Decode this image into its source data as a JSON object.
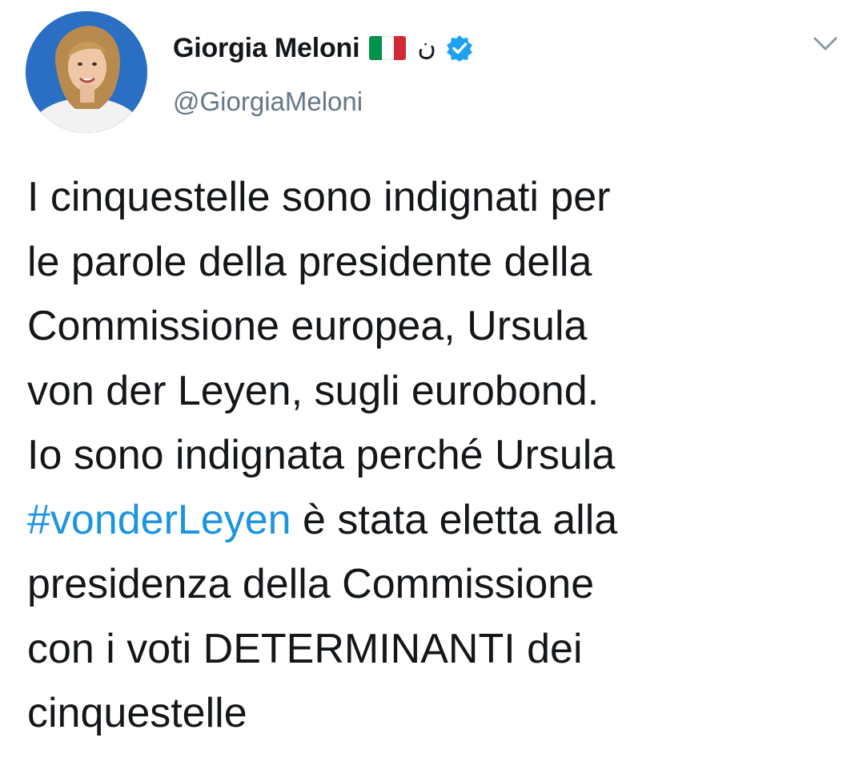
{
  "author": {
    "display_name": "Giorgia Meloni",
    "emoji_flag": "italian-flag",
    "arabic_glyph": "ن",
    "verified": true,
    "handle": "@GiorgiaMeloni"
  },
  "menu": {
    "icon": "chevron-down-icon"
  },
  "tweet": {
    "lines": [
      "I cinquestelle sono indignati per",
      "le parole della presidente della",
      "Commissione europea, Ursula",
      "von der Leyen, sugli eurobond.",
      "Io sono indignata perché Ursula"
    ],
    "hashtag_line": {
      "hashtag": "#vonderLeyen",
      "rest": " è stata eletta alla"
    },
    "lines_after": [
      "presidenza della Commissione",
      "con i voti DETERMINANTI dei",
      "cinquestelle"
    ]
  },
  "colors": {
    "text": "#14171a",
    "secondary": "#657786",
    "link": "#1b95e0",
    "verified": "#1da1f2",
    "flag_green": "#009246",
    "flag_white": "#ffffff",
    "flag_red": "#ce2b37"
  }
}
